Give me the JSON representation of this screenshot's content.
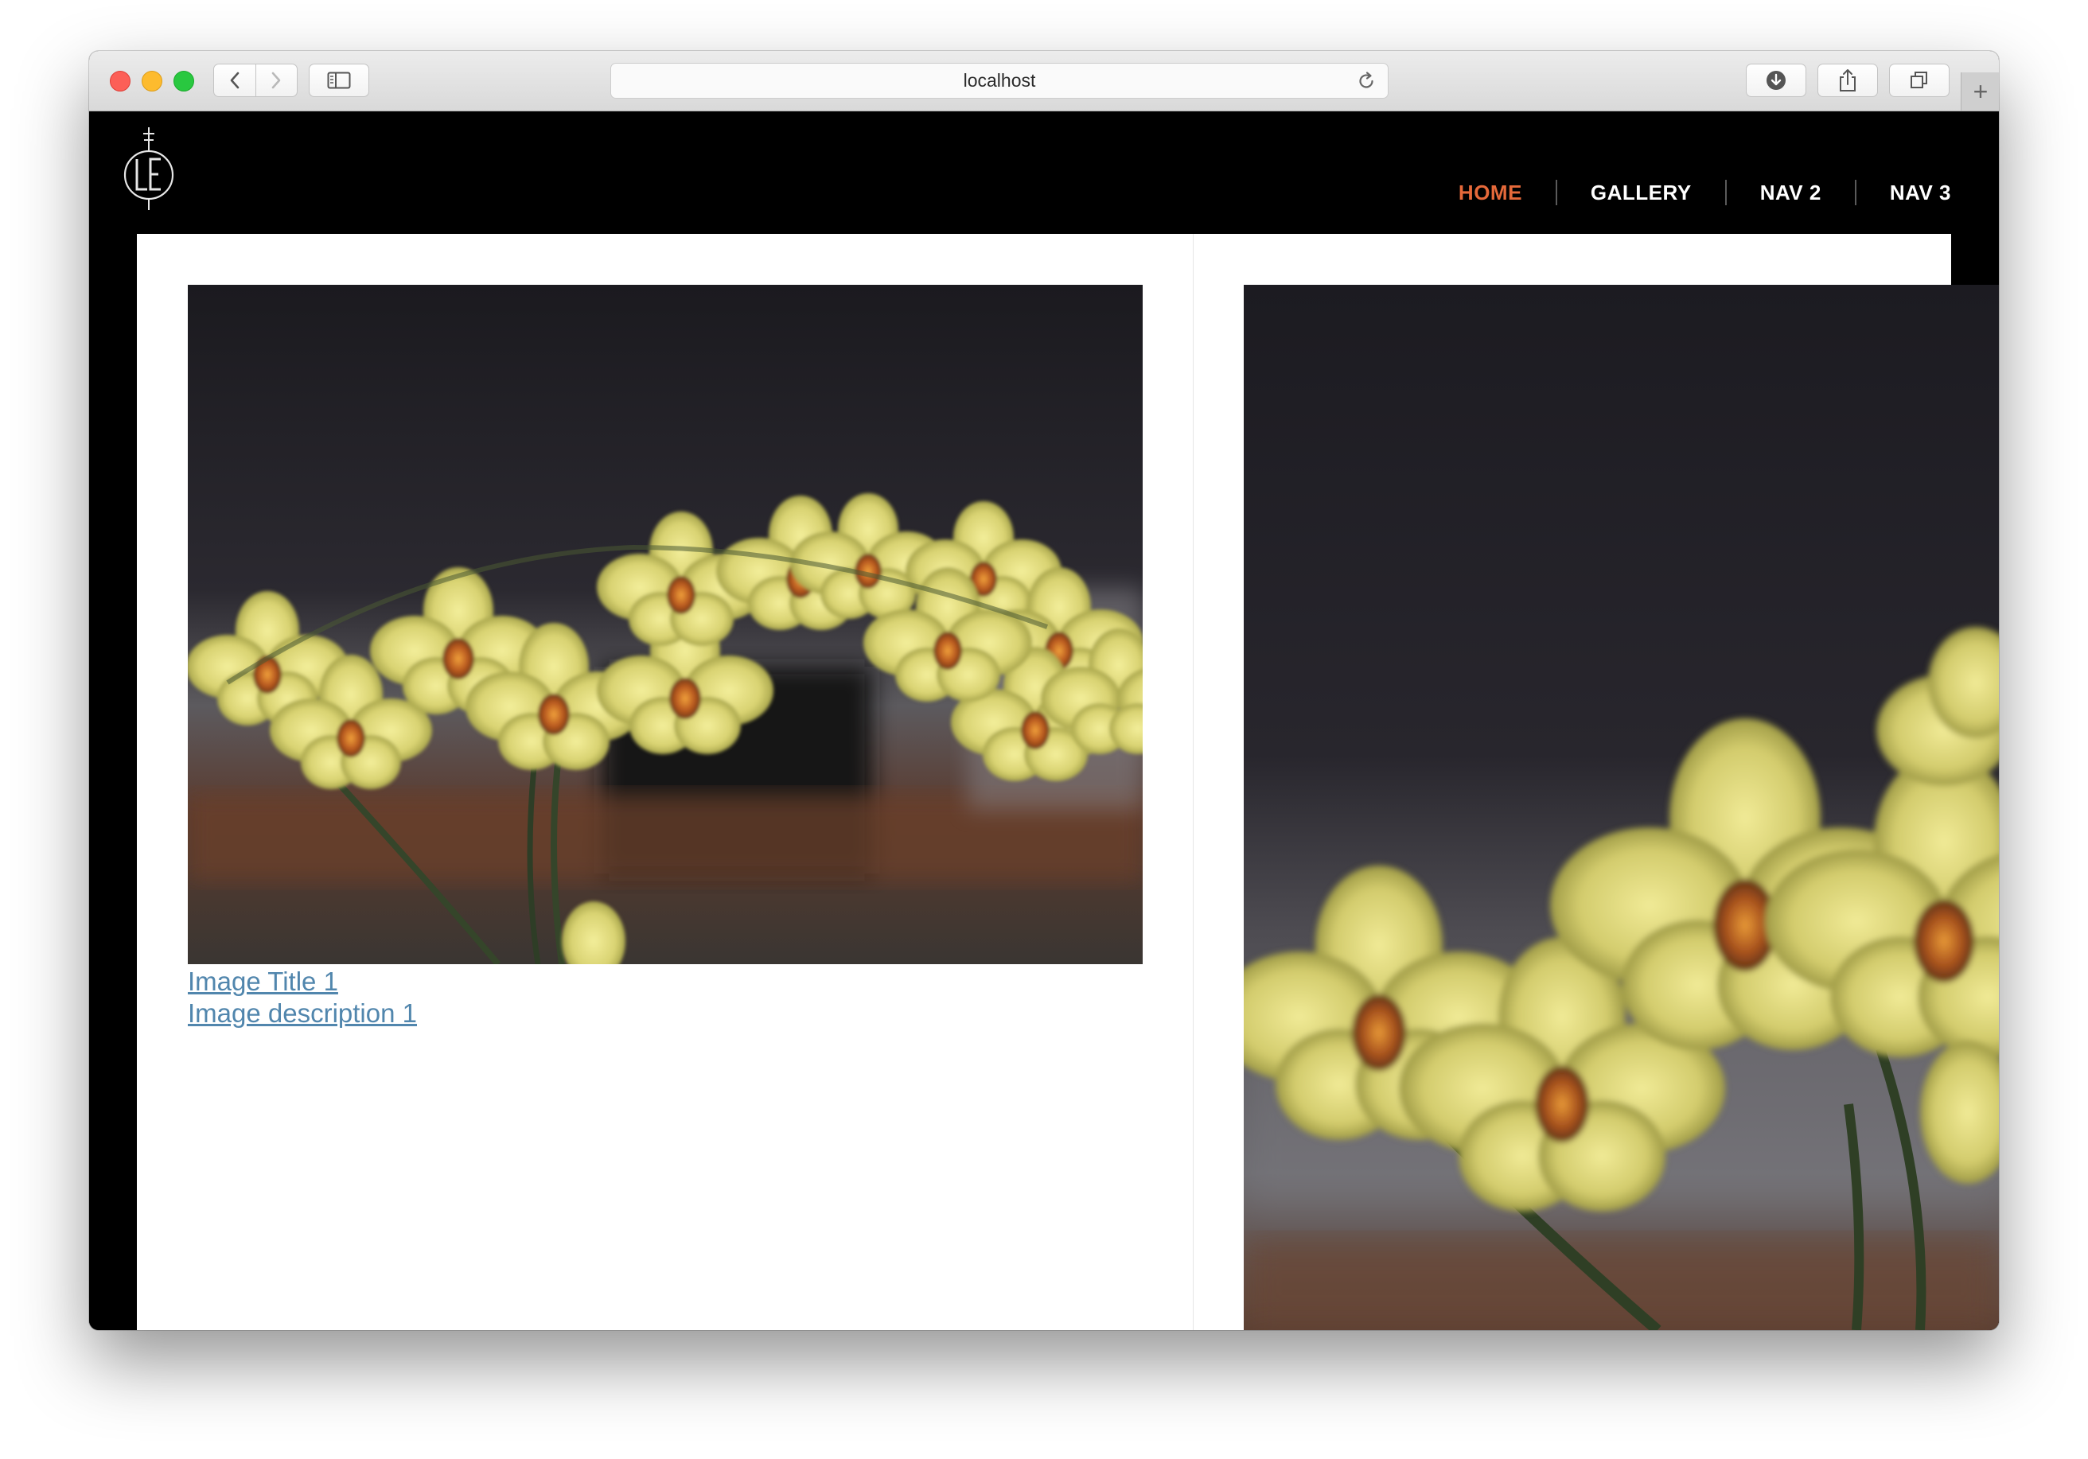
{
  "browser": {
    "url": "localhost",
    "icons": {
      "back": "chevron-left-icon",
      "forward": "chevron-right-icon",
      "sidebar": "sidebar-icon",
      "reload": "reload-icon",
      "download": "download-icon",
      "share": "share-icon",
      "tabs": "tabs-icon",
      "new_tab": "plus-icon"
    },
    "new_tab_label": "+"
  },
  "site": {
    "logo_alt": "LE",
    "nav": [
      {
        "label": "HOME",
        "active": true
      },
      {
        "label": "GALLERY",
        "active": false
      },
      {
        "label": "NAV 2",
        "active": false
      },
      {
        "label": "NAV 3",
        "active": false
      }
    ],
    "accent_color": "#e6693a",
    "link_color": "#5186ad"
  },
  "gallery": {
    "items": [
      {
        "image": "yellow orchids photo",
        "title": "Image Title 1",
        "description": "Image description 1"
      },
      {
        "image": "yellow orchids close-up photo"
      }
    ]
  }
}
